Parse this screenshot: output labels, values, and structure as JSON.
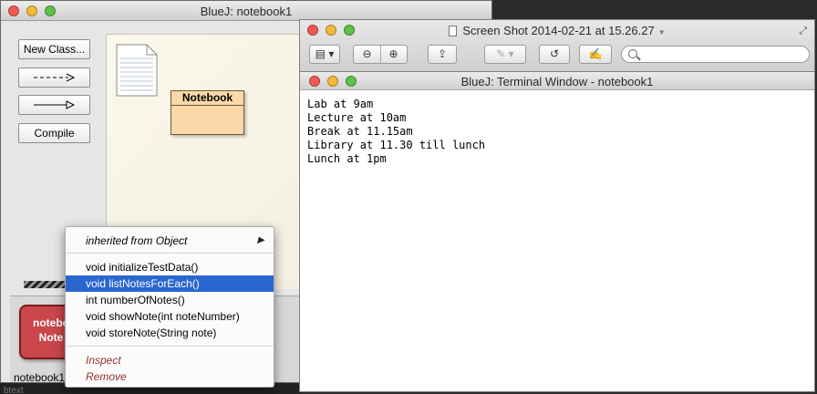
{
  "bluej": {
    "title": "BlueJ:  notebook1",
    "toolbar": {
      "new_class": "New Class...",
      "compile": "Compile"
    },
    "class_name": "Notebook",
    "object": {
      "line1": "notebo",
      "line2": "Note",
      "label": "notebook1"
    }
  },
  "context_menu": {
    "inherited": "inherited from Object",
    "methods": [
      "void initializeTestData()",
      "void listNotesForEach()",
      "int numberOfNotes()",
      "void showNote(int noteNumber)",
      "void storeNote(String note)"
    ],
    "selected_index": 1,
    "inspect": "Inspect",
    "remove": "Remove"
  },
  "preview": {
    "title": "Screen Shot 2014-02-21 at 15.26.27"
  },
  "terminal": {
    "title": "BlueJ: Terminal Window - notebook1",
    "lines": [
      "Lab at 9am",
      "Lecture at 10am",
      "Break at 11.15am",
      "Library at 11.30 till lunch",
      "Lunch at 1pm"
    ]
  },
  "bottom_strip": "btext",
  "colors": {
    "selection": "#2a66cf",
    "class_fill": "#fbd8a8",
    "object_fill": "#c9464a",
    "menu_red": "#963030"
  }
}
